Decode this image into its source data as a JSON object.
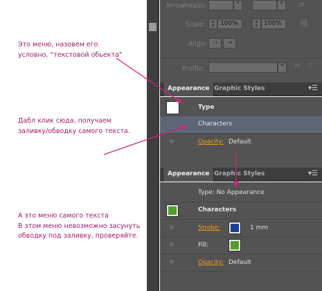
{
  "annotations": {
    "note1": [
      "Это меню, назовем его",
      "условно, “текстовой обьекта”"
    ],
    "note2": [
      "Дабл клик сюда, получаем",
      "заливку/обводку самого текста."
    ],
    "note3": [
      "А это меню самого текста",
      "В этом меню невозможно засунуть",
      "обводку под заливку, проверяйте."
    ]
  },
  "stroke_panel": {
    "arrowheads_label": "Arrowheads:",
    "scale_label": "Scale:",
    "scale_start": "100%",
    "scale_end": "100%",
    "align_label": "Align:",
    "profile_label": "Profile:"
  },
  "appearance_top": {
    "tab_active": "Appearance",
    "tab_inactive": "Graphic Styles",
    "object_label": "Type",
    "selected_item": "Characters",
    "opacity_label": "Opacity:",
    "opacity_value": "Default"
  },
  "appearance_bottom": {
    "tab_active": "Appearance",
    "tab_inactive": "Graphic Styles",
    "type_line": "Type: No Appearance",
    "object_label": "Characters",
    "stroke_label": "Stroke:",
    "stroke_weight": "1 mm",
    "fill_label": "Fill:",
    "opacity_label": "Opacity:",
    "opacity_value": "Default"
  },
  "colors": {
    "annotation": "#a0186f",
    "arrow": "#d4237f",
    "panel_bg": "#535353",
    "selected_row": "#5c6677",
    "link": "#ee9d1d",
    "fill_green": "#4fa02a",
    "stroke_blue": "#1d3f9a"
  }
}
